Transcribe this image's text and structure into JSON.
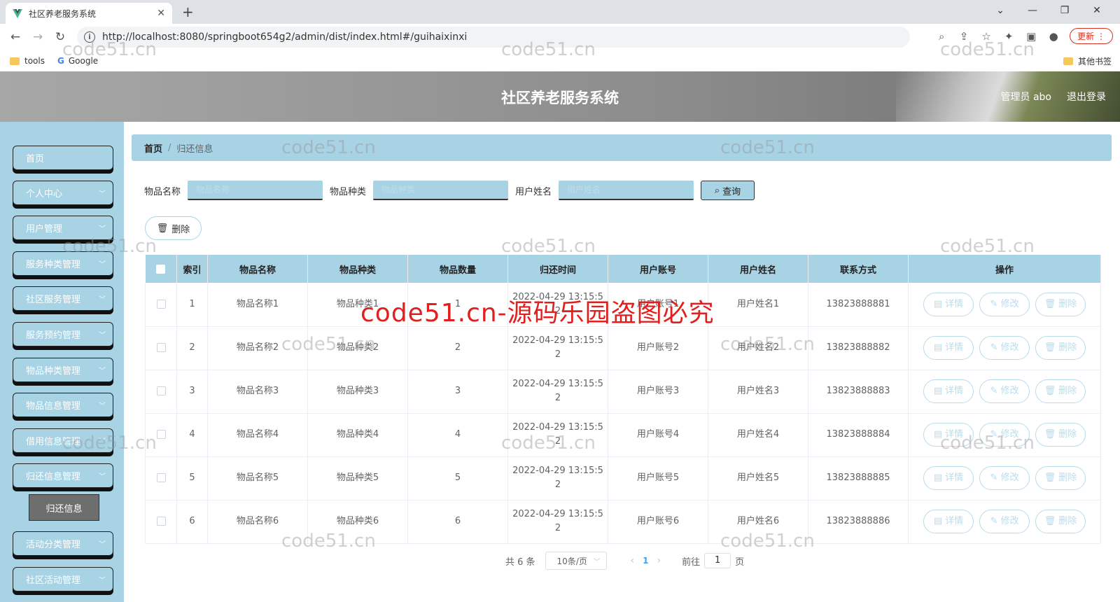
{
  "browser": {
    "tab_title": "社区养老服务系统",
    "url": "http://localhost:8080/springboot654g2/admin/dist/index.html#/guihaixinxi",
    "update_label": "更新",
    "bookmarks": [
      "tools",
      "Google"
    ],
    "other_bookmarks": "其他书签"
  },
  "header": {
    "title": "社区养老服务系统",
    "user": "管理员 abo",
    "logout": "退出登录"
  },
  "sidebar": {
    "items": [
      {
        "label": "首页",
        "has_chevron": false
      },
      {
        "label": "个人中心",
        "has_chevron": true
      },
      {
        "label": "用户管理",
        "has_chevron": true
      },
      {
        "label": "服务种类管理",
        "has_chevron": true
      },
      {
        "label": "社区服务管理",
        "has_chevron": true
      },
      {
        "label": "服务预约管理",
        "has_chevron": true
      },
      {
        "label": "物品种类管理",
        "has_chevron": true
      },
      {
        "label": "物品信息管理",
        "has_chevron": true
      },
      {
        "label": "借用信息管理",
        "has_chevron": true
      },
      {
        "label": "归还信息管理",
        "has_chevron": true
      },
      {
        "label": "活动分类管理",
        "has_chevron": true
      },
      {
        "label": "社区活动管理",
        "has_chevron": true
      }
    ],
    "active_sub": "归还信息"
  },
  "breadcrumb": {
    "home": "首页",
    "current": "归还信息"
  },
  "search": {
    "fields": [
      {
        "label": "物品名称",
        "placeholder": "物品名称"
      },
      {
        "label": "物品种类",
        "placeholder": "物品种类"
      },
      {
        "label": "用户姓名",
        "placeholder": "用户姓名"
      }
    ],
    "query_label": "查询"
  },
  "actions": {
    "delete_label": "删除"
  },
  "table": {
    "columns": [
      "索引",
      "物品名称",
      "物品种类",
      "物品数量",
      "归还时间",
      "用户账号",
      "用户姓名",
      "联系方式",
      "操作"
    ],
    "rows": [
      {
        "index": "1",
        "name": "物品名称1",
        "kind": "物品种类1",
        "qty": "1",
        "time": "2022-04-29 13:15:5\n2",
        "account": "用户账号1",
        "user": "用户姓名1",
        "phone": "13823888881"
      },
      {
        "index": "2",
        "name": "物品名称2",
        "kind": "物品种类2",
        "qty": "2",
        "time": "2022-04-29 13:15:5\n2",
        "account": "用户账号2",
        "user": "用户姓名2",
        "phone": "13823888882"
      },
      {
        "index": "3",
        "name": "物品名称3",
        "kind": "物品种类3",
        "qty": "3",
        "time": "2022-04-29 13:15:5\n2",
        "account": "用户账号3",
        "user": "用户姓名3",
        "phone": "13823888883"
      },
      {
        "index": "4",
        "name": "物品名称4",
        "kind": "物品种类4",
        "qty": "4",
        "time": "2022-04-29 13:15:5\n2",
        "account": "用户账号4",
        "user": "用户姓名4",
        "phone": "13823888884"
      },
      {
        "index": "5",
        "name": "物品名称5",
        "kind": "物品种类5",
        "qty": "5",
        "time": "2022-04-29 13:15:5\n2",
        "account": "用户账号5",
        "user": "用户姓名5",
        "phone": "13823888885"
      },
      {
        "index": "6",
        "name": "物品名称6",
        "kind": "物品种类6",
        "qty": "6",
        "time": "2022-04-29 13:15:5\n2",
        "account": "用户账号6",
        "user": "用户姓名6",
        "phone": "13823888886"
      }
    ],
    "row_actions": [
      "详情",
      "修改",
      "删除"
    ]
  },
  "pagination": {
    "total": "共 6 条",
    "page_size": "10条/页",
    "current_page": "1",
    "goto_prefix": "前往",
    "goto_value": "1",
    "goto_suffix": "页"
  },
  "watermark": {
    "text": "code51.cn",
    "banner": "code51.cn-源码乐园盗图必究"
  },
  "colors": {
    "accent": "#a8d3e5",
    "header": "#8c8c8c",
    "watermark_red": "#e0201e"
  }
}
